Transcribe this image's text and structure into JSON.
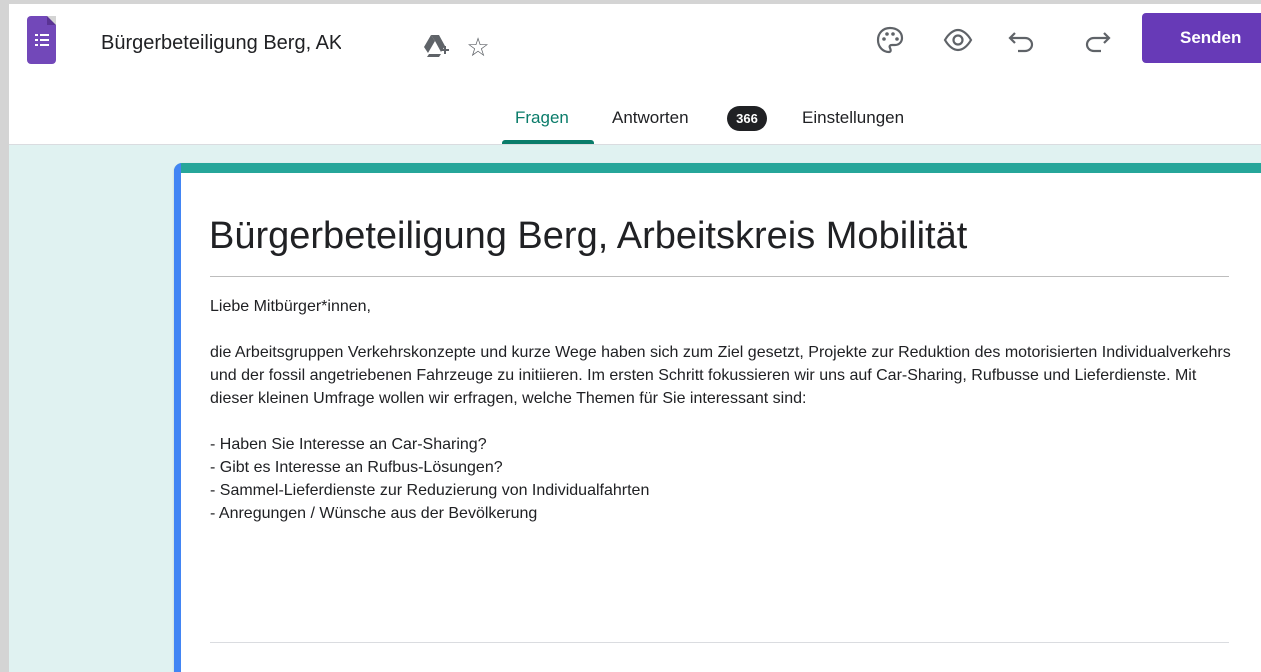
{
  "header": {
    "doc_title": "Bürgerbeteiligung Berg, AK Mobilität",
    "send_label": "Senden",
    "icons": [
      "forms-app-icon",
      "drive-icon",
      "star-icon",
      "palette-icon",
      "preview-icon",
      "undo-icon",
      "redo-icon"
    ]
  },
  "tabs": {
    "questions": "Fragen",
    "responses": "Antworten",
    "responses_count": "366",
    "settings": "Einstellungen",
    "active": "Fragen"
  },
  "form": {
    "title": "Bürgerbeteiligung Berg, Arbeitskreis Mobilität",
    "greeting": "Liebe Mitbürger*innen,",
    "intro": "die Arbeitsgruppen Verkehrskonzepte und kurze Wege haben sich zum Ziel gesetzt, Projekte zur Reduktion des motorisierten Individualverkehrs und der fossil angetriebenen Fahrzeuge zu initiieren. Im ersten Schritt fokussieren wir uns auf Car-Sharing, Rufbusse und Lieferdienste. Mit dieser kleinen Umfrage wollen wir erfragen, welche Themen für Sie interessant sind:",
    "topics": [
      "- Haben Sie Interesse an Car-Sharing?",
      "- Gibt es Interesse an Rufbus-Lösungen?",
      "- Sammel-Lieferdienste zur Reduzierung von Individualfahrten",
      "- Anregungen / Wünsche aus der Bevölkerung"
    ]
  },
  "colors": {
    "brand_purple": "#673ab7",
    "tab_active": "#0a7c6a",
    "card_accent_top": "#26a69a",
    "card_accent_left": "#4285f4",
    "canvas_bg": "#e0f2f1"
  }
}
